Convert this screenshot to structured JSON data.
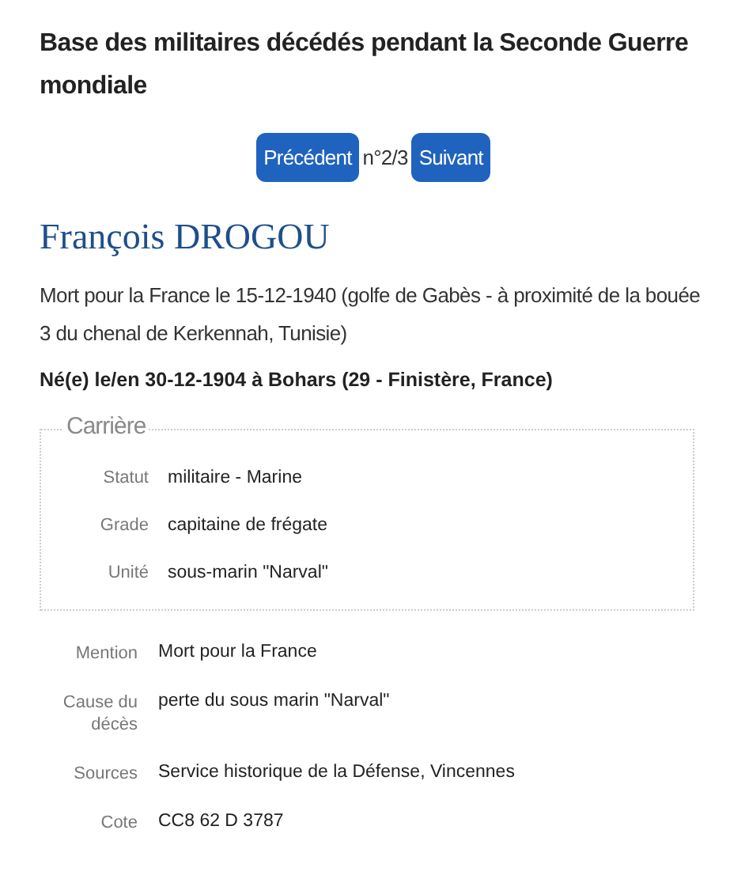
{
  "title": "Base des militaires décédés pendant la Seconde Guerre mondiale",
  "pager": {
    "previous": "Précédent",
    "position": "n°2/3",
    "next": "Suivant"
  },
  "name": "François DROGOU",
  "death": "Mort pour la France le 15-12-1940 (golfe de Gabès - à proximité de la bouée 3 du chenal de Kerkennah, Tunisie)",
  "birth": "Né(e) le/en 30-12-1904 à Bohars (29 - Finistère, France)",
  "career": {
    "legend": "Carrière",
    "rows": [
      {
        "label": "Statut",
        "value": "militaire - Marine"
      },
      {
        "label": "Grade",
        "value": "capitaine de frégate"
      },
      {
        "label": "Unité",
        "value": "sous-marin \"Narval\""
      }
    ]
  },
  "details": [
    {
      "label": "Mention",
      "value": "Mort pour la France"
    },
    {
      "label": "Cause du décès",
      "value": "perte du sous marin \"Narval\""
    },
    {
      "label": "Sources",
      "value": "Service historique de la Défense, Vincennes"
    },
    {
      "label": "Cote",
      "value": "CC8 62 D 3787"
    }
  ]
}
